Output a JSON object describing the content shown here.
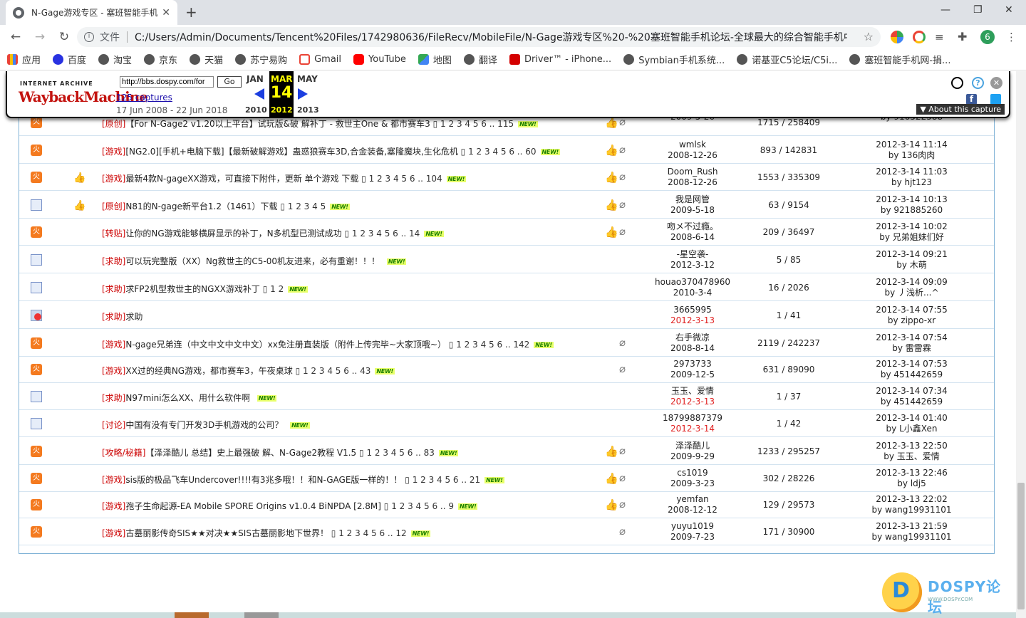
{
  "browser": {
    "tab_title": "N-Gage游戏专区 - 塞班智能手机论坛",
    "address_label": "文件",
    "url": "C:/Users/Admin/Documents/Tencent%20Files/1742980636/FileRecv/MobileFile/N-Gage游戏专区%20-%20塞班智能手机论坛-全球最大的综合智能手机中...",
    "profile_letter": "6",
    "bookmarks": [
      "应用",
      "百度",
      "淘宝",
      "京东",
      "天猫",
      "苏宁易购",
      "Gmail",
      "YouTube",
      "地图",
      "翻译",
      "Driver™ - iPhone...",
      "Symbian手机系统...",
      "诺基亚C5论坛/C5i...",
      "塞班智能手机网-捐..."
    ]
  },
  "wayback": {
    "logo_top": "INTERNET ARCHIVE",
    "logo_main": "WaybackMachine",
    "url_input": "http://bbs.dospy.com/for",
    "go_label": "Go",
    "captures": "125 captures",
    "range": "17 Jun 2008 - 22 Jun 2018",
    "prev_month": "JAN",
    "cur_month": "MAR",
    "next_month": "MAY",
    "prev_year": "2010",
    "cur_day": "14",
    "cur_year": "2012",
    "next_year": "2013",
    "about": "▼ About this capture"
  },
  "threads": [
    {
      "icon": "hot",
      "cat": "[原创]",
      "title": "【For N-Gage2 v1.20以上平台】试玩版&破 解补丁 - 救世主One & 都市赛车3",
      "pages": "1 2 3 4 5 6 .. 115",
      "new": true,
      "rate": true,
      "clip": true,
      "author": "",
      "adate": "2009-5-26",
      "adate_red": false,
      "stats": "1715 / 258409",
      "ltime": "",
      "lby": "by 916522588",
      "thumb": false
    },
    {
      "icon": "hot",
      "cat": "[游戏]",
      "title": "[NG2.0][手机+电脑下载]【最新破解游戏】蛊惑狼赛车3D,合金装备,塞隆魔块,生化危机",
      "pages": "1 2 3 4 5 6 .. 60",
      "new": true,
      "rate": true,
      "clip": true,
      "author": "wmlsk",
      "adate": "2008-12-26",
      "adate_red": false,
      "stats": "893 / 142831",
      "ltime": "2012-3-14 11:14",
      "lby": "by 136肉肉",
      "thumb": false
    },
    {
      "icon": "hot",
      "cat": "[游戏]",
      "title": "最新4款N-gageXX游戏，可直接下附件，更新 单个游戏 下载",
      "pages": "1 2 3 4 5 6 .. 104",
      "new": true,
      "rate": true,
      "clip": true,
      "author": "Doom_Rush",
      "adate": "2008-12-26",
      "adate_red": false,
      "stats": "1553 / 335309",
      "ltime": "2012-3-14 11:03",
      "lby": "by hjt123",
      "thumb": true
    },
    {
      "icon": "doc",
      "cat": "[原创]",
      "title": "N81的N-gage新平台1.2（1461）下载",
      "pages": "1 2 3 4 5",
      "new": true,
      "rate": true,
      "clip": true,
      "author": "我是网管",
      "adate": "2009-5-18",
      "adate_red": false,
      "stats": "63 / 9154",
      "ltime": "2012-3-14 10:13",
      "lby": "by 921885260",
      "thumb": true
    },
    {
      "icon": "hot",
      "cat": "[转贴]",
      "title": "让你的NG游戏能够横屏显示的补丁，N多机型已测试成功",
      "pages": "1 2 3 4 5 6 .. 14",
      "new": true,
      "rate": true,
      "clip": true,
      "author": "吻メ不过瘾。",
      "adate": "2008-6-14",
      "adate_red": false,
      "stats": "209 / 36497",
      "ltime": "2012-3-14 10:02",
      "lby": "by 兄弟姐妹们好",
      "thumb": false
    },
    {
      "icon": "doc",
      "cat": "[求助]",
      "title": "可以玩完整版（XX）Ng救世主的C5-00机友进来，必有重谢！！！",
      "pages": "",
      "new": true,
      "rate": false,
      "clip": false,
      "author": "-星空袭-",
      "adate": "2012-3-12",
      "adate_red": false,
      "stats": "5 / 85",
      "ltime": "2012-3-14 09:21",
      "lby": "by 木萌",
      "thumb": false
    },
    {
      "icon": "doc",
      "cat": "[求助]",
      "title": "求FP2机型救世主的NGXX游戏补丁",
      "pages": "1 2",
      "new": true,
      "rate": false,
      "clip": false,
      "author": "houao370478960",
      "adate": "2010-3-4",
      "adate_red": false,
      "stats": "16 / 2026",
      "ltime": "2012-3-14 09:09",
      "lby": "by 丿浅析...^",
      "thumb": false
    },
    {
      "icon": "lock",
      "cat": "[求助]",
      "title": "求助",
      "pages": "",
      "new": false,
      "rate": false,
      "clip": false,
      "author": "3665995",
      "adate": "2012-3-13",
      "adate_red": true,
      "stats": "1 / 41",
      "ltime": "2012-3-14 07:55",
      "lby": "by zippo-xr",
      "thumb": false
    },
    {
      "icon": "hot",
      "cat": "[游戏]",
      "title": "N-gage兄弟连（中文中文中文中文）xx免注册直装版（附件上传完毕~大家顶哦~）",
      "pages": "1 2 3 4 5 6 .. 142",
      "new": true,
      "rate": false,
      "clip": true,
      "author": "右手微凉",
      "adate": "2008-8-14",
      "adate_red": false,
      "stats": "2119 / 242237",
      "ltime": "2012-3-14 07:54",
      "lby": "by 雷雷霖",
      "thumb": false
    },
    {
      "icon": "hot",
      "cat": "[游戏]",
      "title": "XX过的经典NG游戏，都市赛车3，午夜桌球",
      "pages": "1 2 3 4 5 6 .. 43",
      "new": true,
      "rate": false,
      "clip": true,
      "author": "2973733",
      "adate": "2009-12-5",
      "adate_red": false,
      "stats": "631 / 89090",
      "ltime": "2012-3-14 07:53",
      "lby": "by 451442659",
      "thumb": false
    },
    {
      "icon": "doc",
      "cat": "[求助]",
      "title": "N97mini怎么XX、用什么软件啊",
      "pages": "",
      "new": true,
      "rate": false,
      "clip": false,
      "author": "玉玉、爱情",
      "adate": "2012-3-13",
      "adate_red": true,
      "stats": "1 / 37",
      "ltime": "2012-3-14 07:34",
      "lby": "by 451442659",
      "thumb": false
    },
    {
      "icon": "doc",
      "cat": "[讨论]",
      "title": "中国有没有专门开发3D手机游戏的公司？",
      "pages": "",
      "new": true,
      "rate": false,
      "clip": false,
      "author": "18799887379",
      "adate": "2012-3-14",
      "adate_red": true,
      "stats": "1 / 42",
      "ltime": "2012-3-14 01:40",
      "lby": "by L小鑫Xen",
      "thumb": false
    },
    {
      "icon": "hot",
      "cat": "[攻略/秘籍]",
      "title": "【泽泽酷儿 总结】史上最强破 解、N-Gage2教程 V1.5",
      "pages": "1 2 3 4 5 6 .. 83",
      "new": true,
      "rate": true,
      "clip": true,
      "author": "泽泽酷儿",
      "adate": "2009-9-29",
      "adate_red": false,
      "stats": "1233 / 295257",
      "ltime": "2012-3-13 22:50",
      "lby": "by 玉玉、爱情",
      "thumb": false
    },
    {
      "icon": "hot",
      "cat": "[游戏]",
      "title": "sis版的极品飞车Undercover!!!!有3兆多哦！！和N-GAGE版一样的！！",
      "pages": "1 2 3 4 5 6 .. 21",
      "new": true,
      "rate": true,
      "clip": true,
      "author": "cs1019",
      "adate": "2009-3-23",
      "adate_red": false,
      "stats": "302 / 28226",
      "ltime": "2012-3-13 22:46",
      "lby": "by ldj5",
      "thumb": false
    },
    {
      "icon": "hot",
      "cat": "[游戏]",
      "title": "孢子生命起源-EA Mobile SPORE Origins v1.0.4 BiNPDA [2.8M]",
      "pages": "1 2 3 4 5 6 .. 9",
      "new": true,
      "rate": true,
      "clip": true,
      "author": "yemfan",
      "adate": "2008-12-12",
      "adate_red": false,
      "stats": "129 / 29573",
      "ltime": "2012-3-13 22:02",
      "lby": "by wang19931101",
      "thumb": false
    },
    {
      "icon": "hot",
      "cat": "[游戏]",
      "title": "古墓丽影传奇SIS★★对决★★SIS古墓丽影地下世界！",
      "pages": "1 2 3 4 5 6 .. 12",
      "new": true,
      "rate": false,
      "clip": true,
      "author": "yuyu1019",
      "adate": "2009-7-23",
      "adate_red": false,
      "stats": "171 / 30900",
      "ltime": "2012-3-13 21:59",
      "lby": "by wang19931101",
      "thumb": false
    }
  ],
  "dospy": {
    "brand": "DOSPY论坛",
    "sub": "WWW.DOSPY.COM"
  }
}
